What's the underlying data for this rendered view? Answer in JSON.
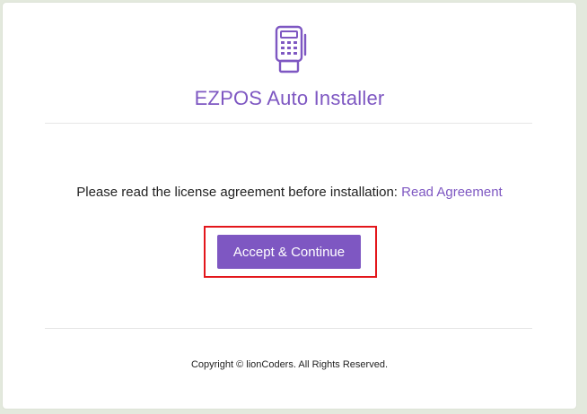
{
  "app": {
    "title": "EZPOS Auto Installer",
    "logo_icon": "pos-terminal-icon"
  },
  "license": {
    "prompt": "Please read the license agreement before installation:",
    "link_label": "Read Agreement"
  },
  "actions": {
    "accept_label": "Accept & Continue"
  },
  "footer": {
    "copyright": "Copyright © lionCoders. All Rights Reserved."
  },
  "colors": {
    "accent": "#7e57c2",
    "highlight_border": "#e3161b",
    "page_background": "#e3e9dd"
  }
}
